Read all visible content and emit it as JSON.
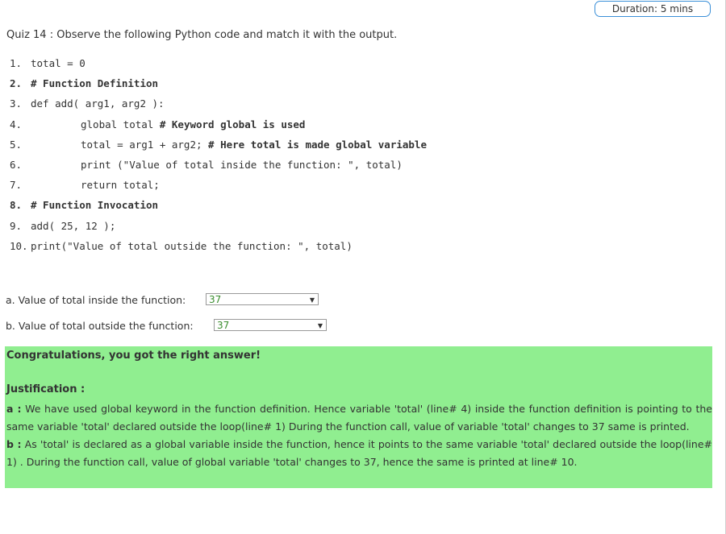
{
  "header": {
    "duration": "Duration: 5 mins"
  },
  "quiz": {
    "title": "Quiz 14 : Observe the following Python code and match it with the output."
  },
  "code": {
    "lines": [
      {
        "num": "1.",
        "text": "total = 0",
        "bold": false,
        "indent": false
      },
      {
        "num": "2.",
        "text": "# Function Definition",
        "bold": true,
        "indent": false
      },
      {
        "num": "3.",
        "text": "def add( arg1, arg2 ):",
        "bold": false,
        "indent": false
      },
      {
        "num": "4.",
        "text": "global total ",
        "bold_suffix": "# Keyword global is used",
        "indent": true
      },
      {
        "num": "5.",
        "text": "total = arg1 + arg2; ",
        "bold_suffix": "# Here total is made global variable",
        "indent": true
      },
      {
        "num": "6.",
        "text": "print (\"Value of total inside the function: \", total)",
        "indent": true
      },
      {
        "num": "7.",
        "text": "return total;",
        "indent": true
      },
      {
        "num": "8.",
        "text": "# Function Invocation",
        "bold": true,
        "indent": false
      },
      {
        "num": "9.",
        "text": "add( 25, 12 );",
        "indent": false
      },
      {
        "num": "10.",
        "text": "print(\"Value of total outside the function: \", total)",
        "indent": false
      }
    ]
  },
  "questions": [
    {
      "label": "a. Value of total inside the function:",
      "selected": "37"
    },
    {
      "label": "b. Value of total outside the function:",
      "selected": "37"
    }
  ],
  "feedback": {
    "result": "Congratulations, you got the right answer!",
    "justification_title": "Justification :",
    "a_key": "a :",
    "a_text": " We have used global keyword in the function definition. Hence variable 'total' (line# 4) inside the function definition is pointing to the same variable 'total' declared outside the loop(line# 1) During the function call, value of variable 'total' changes to 37 same is printed.",
    "b_key": "b :",
    "b_text": " As 'total' is declared as a global variable inside the function, hence it points to the same variable 'total' declared outside the loop(line# 1) . During the function call, value of global variable 'total' changes to 37, hence the same is printed at line# 10."
  },
  "colors": {
    "feedback_bg": "#90ee90",
    "duration_border": "#3a8fd8",
    "selected_value": "#3a8d2e"
  }
}
